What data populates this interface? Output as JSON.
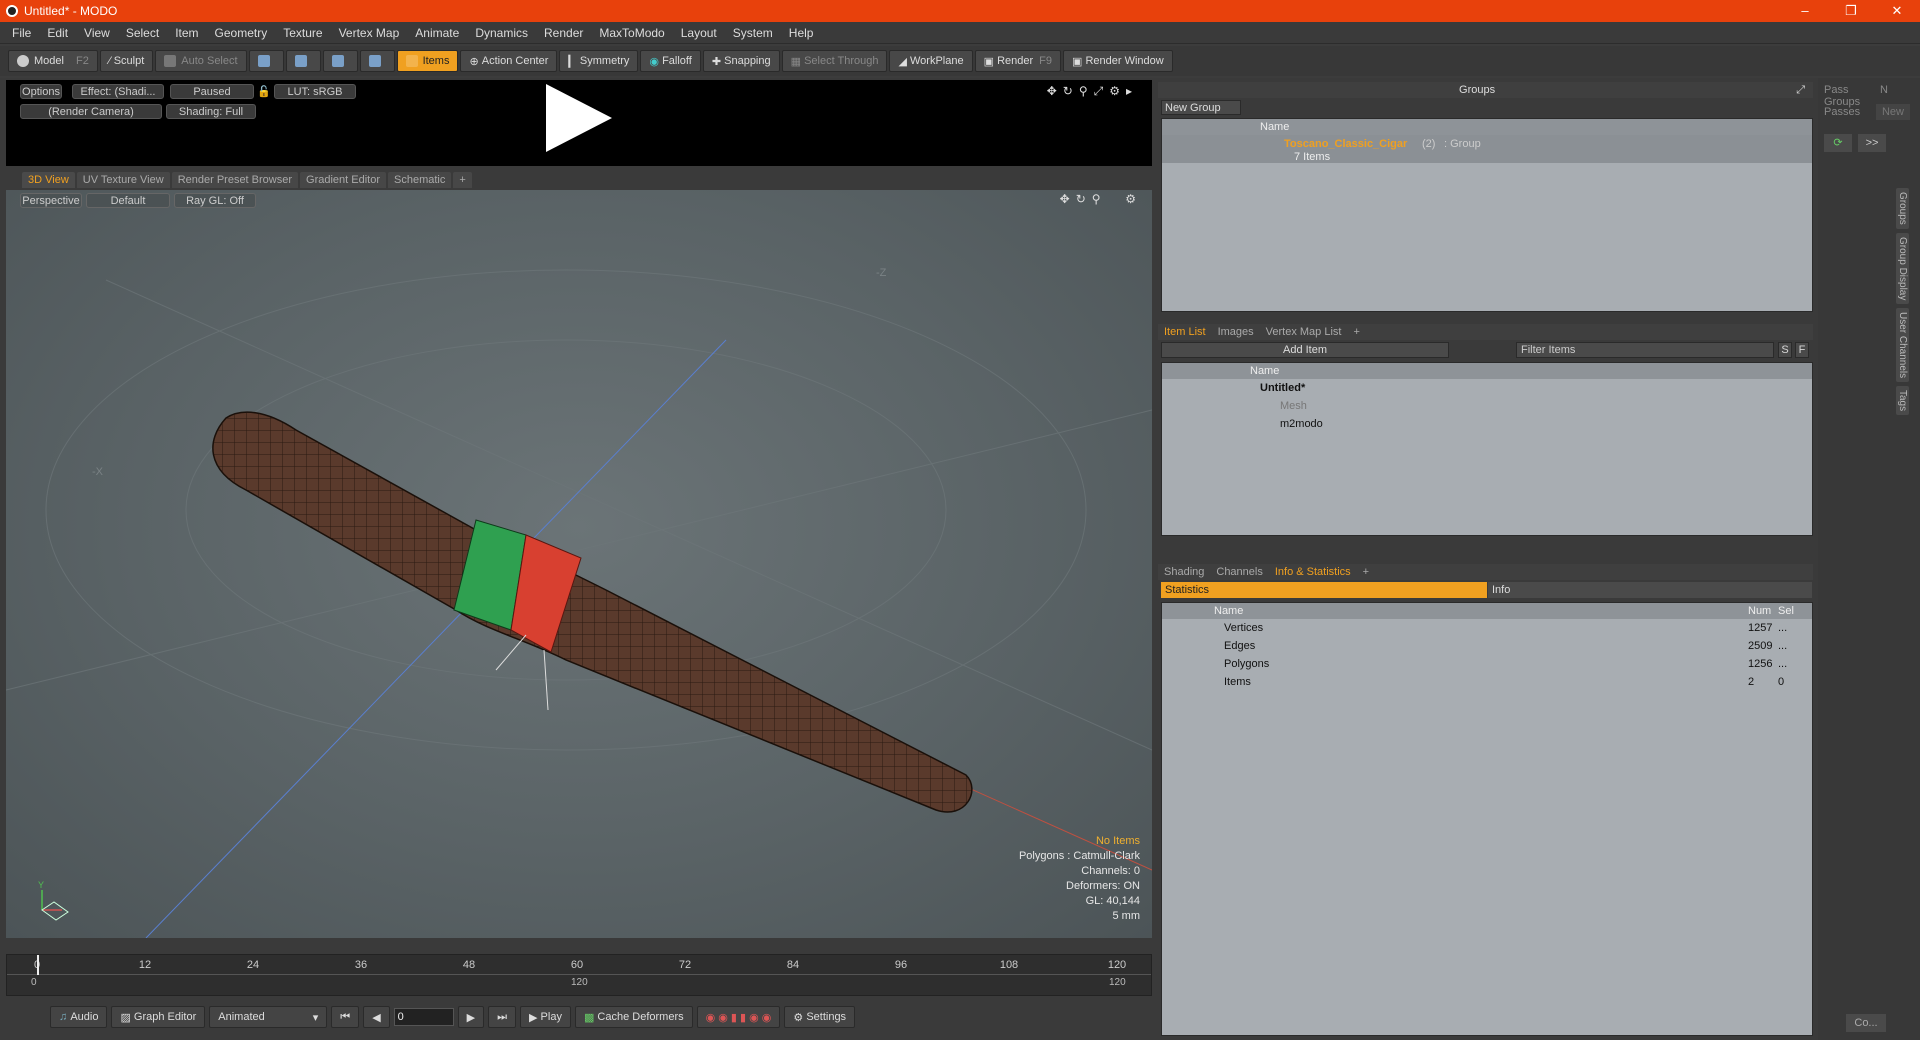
{
  "window": {
    "title": "Untitled* - MODO"
  },
  "menu": [
    "File",
    "Edit",
    "View",
    "Select",
    "Item",
    "Geometry",
    "Texture",
    "Vertex Map",
    "Animate",
    "Dynamics",
    "Render",
    "MaxToModo",
    "Layout",
    "System",
    "Help"
  ],
  "toolbar": {
    "model": "Model",
    "model_key": "F2",
    "sculpt": "Sculpt",
    "auto_select": "Auto Select",
    "items": "Items",
    "action_center": "Action Center",
    "symmetry": "Symmetry",
    "falloff": "Falloff",
    "snapping": "Snapping",
    "select_through": "Select Through",
    "workplane": "WorkPlane",
    "render": "Render",
    "render_key": "F9",
    "render_window": "Render Window"
  },
  "render_bar": {
    "options": "Options",
    "effect": "Effect: (Shadi...",
    "paused": "Paused",
    "lut": "LUT: sRGB",
    "camera": "(Render Camera)",
    "shading": "Shading: Full"
  },
  "view_tabs": [
    "3D View",
    "UV Texture View",
    "Render Preset Browser",
    "Gradient Editor",
    "Schematic"
  ],
  "viewport": {
    "perspective": "Perspective",
    "default": "Default",
    "raygl": "Ray GL: Off",
    "stats": {
      "items": "No Items",
      "polygons": "Polygons : Catmull-Clark",
      "channels": "Channels: 0",
      "deformers": "Deformers: ON",
      "gl": "GL: 40,144",
      "scale": "5 mm"
    }
  },
  "timeline": {
    "ticks": [
      "0",
      "12",
      "24",
      "36",
      "48",
      "60",
      "72",
      "84",
      "96",
      "108",
      "120"
    ],
    "start": "0",
    "mid": "120",
    "end": "120"
  },
  "bottombar": {
    "audio": "Audio",
    "graph_editor": "Graph Editor",
    "animated": "Animated",
    "frame": "0",
    "play": "Play",
    "cache_deformers": "Cache Deformers",
    "settings": "Settings"
  },
  "groups": {
    "title": "Groups",
    "new_group": "New Group",
    "col_name": "Name",
    "row_name": "Toscano_Classic_Cigar",
    "row_count": "(2)",
    "row_type": ": Group",
    "row_items": "7 Items"
  },
  "item_list": {
    "tabs": [
      "Item List",
      "Images",
      "Vertex Map List"
    ],
    "add_item": "Add Item",
    "filter": "Filter Items",
    "s": "S",
    "f": "F",
    "col_name": "Name",
    "rows": [
      "Untitled*",
      "Mesh",
      "m2modo"
    ]
  },
  "info": {
    "tabs": [
      "Shading",
      "Channels",
      "Info & Statistics"
    ],
    "statistics": "Statistics",
    "info": "Info",
    "cols": [
      "Name",
      "Num",
      "Sel"
    ],
    "rows": [
      {
        "name": "Vertices",
        "num": "1257",
        "sel": "..."
      },
      {
        "name": "Edges",
        "num": "2509",
        "sel": "..."
      },
      {
        "name": "Polygons",
        "num": "1256",
        "sel": "..."
      },
      {
        "name": "Items",
        "num": "2",
        "sel": "0"
      }
    ]
  },
  "far_right": {
    "pass_groups": "Pass Groups",
    "passes": "Passes",
    "n": "N",
    "new": "New",
    "vtabs": [
      "Groups",
      "Group Display",
      "User Channels",
      "Tags"
    ],
    "co": "Co..."
  }
}
